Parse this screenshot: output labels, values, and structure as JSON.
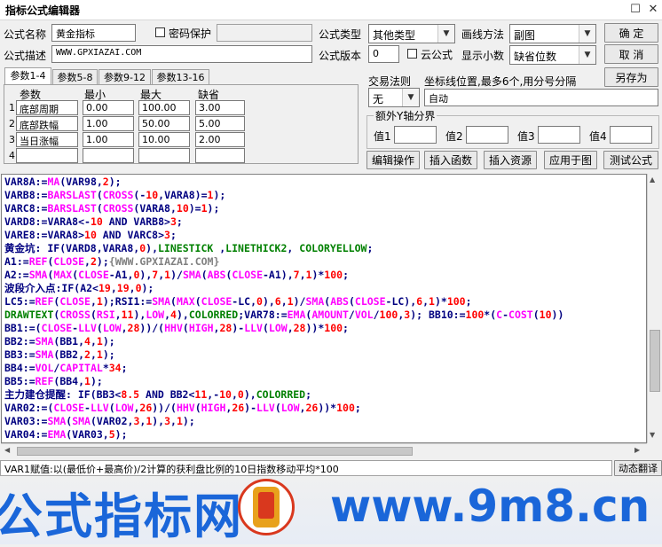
{
  "window": {
    "title": "指标公式编辑器",
    "restore_glyph": "☐",
    "close_glyph": "✕"
  },
  "form": {
    "name_label": "公式名称",
    "name_value": "黄金指标",
    "password_label": "密码保护",
    "desc_label": "公式描述",
    "desc_value": "WWW.GPXIAZAI.COM",
    "type_label": "公式类型",
    "type_value": "其他类型",
    "draw_label": "画线方法",
    "draw_value": "副图",
    "version_label": "公式版本",
    "version_value": "0",
    "cloud_label": "云公式",
    "decimal_label": "显示小数",
    "decimal_value": "缺省位数"
  },
  "buttons": {
    "ok": "确  定",
    "cancel": "取  消",
    "save_as": "另存为"
  },
  "tabs": [
    "参数1-4",
    "参数5-8",
    "参数9-12",
    "参数13-16"
  ],
  "params": {
    "headers": [
      "参数",
      "最小",
      "最大",
      "缺省"
    ],
    "rows": [
      {
        "no": "1",
        "name": "底部周期",
        "min": "0.00",
        "max": "100.00",
        "def": "3.00"
      },
      {
        "no": "2",
        "name": "底部跌幅",
        "min": "1.00",
        "max": "50.00",
        "def": "5.00"
      },
      {
        "no": "3",
        "name": "当日涨幅",
        "min": "1.00",
        "max": "10.00",
        "def": "2.00"
      },
      {
        "no": "4",
        "name": "",
        "min": "",
        "max": "",
        "def": ""
      }
    ]
  },
  "trade": {
    "label": "交易法则",
    "value": "无"
  },
  "axis": {
    "label": "坐标线位置,最多6个,用分号分隔",
    "value": "自动"
  },
  "yaxis": {
    "group_label": "额外Y轴分界",
    "v1": "值1",
    "v2": "值2",
    "v3": "值3",
    "v4": "值4"
  },
  "actions": [
    "编辑操作",
    "插入函数",
    "插入资源",
    "应用于图",
    "测试公式"
  ],
  "code_lines": [
    [
      [
        "VAR8A:=",
        "#000080"
      ],
      [
        "MA",
        "#ff00ff"
      ],
      [
        "(VAR98,",
        "#000080"
      ],
      [
        "2",
        "#ff0000"
      ],
      [
        ");",
        "#000080"
      ]
    ],
    [
      [
        "VARB8:=",
        "#000080"
      ],
      [
        "BARSLAST",
        "#ff00ff"
      ],
      [
        "(",
        "#000080"
      ],
      [
        "CROSS",
        "#ff00ff"
      ],
      [
        "(-",
        "#000080"
      ],
      [
        "10",
        "#ff0000"
      ],
      [
        ",VARA8)=",
        "#000080"
      ],
      [
        "1",
        "#ff0000"
      ],
      [
        ");",
        "#000080"
      ]
    ],
    [
      [
        "VARC8:=",
        "#000080"
      ],
      [
        "BARSLAST",
        "#ff00ff"
      ],
      [
        "(",
        "#000080"
      ],
      [
        "CROSS",
        "#ff00ff"
      ],
      [
        "(VARA8,",
        "#000080"
      ],
      [
        "10",
        "#ff0000"
      ],
      [
        ")=",
        "#000080"
      ],
      [
        "1",
        "#ff0000"
      ],
      [
        ");",
        "#000080"
      ]
    ],
    [
      [
        "VARD8:=VARA8<-",
        "#000080"
      ],
      [
        "10",
        "#ff0000"
      ],
      [
        " AND VARB8>",
        "#000080"
      ],
      [
        "3",
        "#ff0000"
      ],
      [
        ";",
        "#000080"
      ]
    ],
    [
      [
        "VARE8:=VARA8>",
        "#000080"
      ],
      [
        "10",
        "#ff0000"
      ],
      [
        " AND VARC8>",
        "#000080"
      ],
      [
        "3",
        "#ff0000"
      ],
      [
        ";",
        "#000080"
      ]
    ],
    [
      [
        "黄金坑: IF(VARD8,VARA8,",
        "#000080"
      ],
      [
        "0",
        "#ff0000"
      ],
      [
        "),",
        "#000080"
      ],
      [
        "LINESTICK",
        "#008000"
      ],
      [
        " ,",
        "#000080"
      ],
      [
        "LINETHICK2",
        "#008000"
      ],
      [
        ", ",
        "#000080"
      ],
      [
        "COLORYELLOW",
        "#008000"
      ],
      [
        ";",
        "#000080"
      ]
    ],
    [
      [
        "A1:=",
        "#000080"
      ],
      [
        "REF",
        "#ff00ff"
      ],
      [
        "(",
        "#000080"
      ],
      [
        "CLOSE",
        "#ff00ff"
      ],
      [
        ",",
        "#000080"
      ],
      [
        "2",
        "#ff0000"
      ],
      [
        ");",
        "#000080"
      ],
      [
        "{WWW.GPXIAZAI.COM}",
        "#808080"
      ]
    ],
    [
      [
        "A2:=",
        "#000080"
      ],
      [
        "SMA",
        "#ff00ff"
      ],
      [
        "(",
        "#000080"
      ],
      [
        "MAX",
        "#ff00ff"
      ],
      [
        "(",
        "#000080"
      ],
      [
        "CLOSE",
        "#ff00ff"
      ],
      [
        "-A1,",
        "#000080"
      ],
      [
        "0",
        "#ff0000"
      ],
      [
        "),",
        "#000080"
      ],
      [
        "7",
        "#ff0000"
      ],
      [
        ",",
        "#000080"
      ],
      [
        "1",
        "#ff0000"
      ],
      [
        ")/",
        "#000080"
      ],
      [
        "SMA",
        "#ff00ff"
      ],
      [
        "(",
        "#000080"
      ],
      [
        "ABS",
        "#ff00ff"
      ],
      [
        "(",
        "#000080"
      ],
      [
        "CLOSE",
        "#ff00ff"
      ],
      [
        "-A1),",
        "#000080"
      ],
      [
        "7",
        "#ff0000"
      ],
      [
        ",",
        "#000080"
      ],
      [
        "1",
        "#ff0000"
      ],
      [
        ")*",
        "#000080"
      ],
      [
        "100",
        "#ff0000"
      ],
      [
        ";",
        "#000080"
      ]
    ],
    [
      [
        "波段介入点:IF(A2<",
        "#000080"
      ],
      [
        "19",
        "#ff0000"
      ],
      [
        ",",
        "#000080"
      ],
      [
        "19",
        "#ff0000"
      ],
      [
        ",",
        "#000080"
      ],
      [
        "0",
        "#ff0000"
      ],
      [
        ");",
        "#000080"
      ]
    ],
    [
      [
        "LC5:=",
        "#000080"
      ],
      [
        "REF",
        "#ff00ff"
      ],
      [
        "(",
        "#000080"
      ],
      [
        "CLOSE",
        "#ff00ff"
      ],
      [
        ",",
        "#000080"
      ],
      [
        "1",
        "#ff0000"
      ],
      [
        ");RSI1:=",
        "#000080"
      ],
      [
        "SMA",
        "#ff00ff"
      ],
      [
        "(",
        "#000080"
      ],
      [
        "MAX",
        "#ff00ff"
      ],
      [
        "(",
        "#000080"
      ],
      [
        "CLOSE",
        "#ff00ff"
      ],
      [
        "-LC,",
        "#000080"
      ],
      [
        "0",
        "#ff0000"
      ],
      [
        "),",
        "#000080"
      ],
      [
        "6",
        "#ff0000"
      ],
      [
        ",",
        "#000080"
      ],
      [
        "1",
        "#ff0000"
      ],
      [
        ")/",
        "#000080"
      ],
      [
        "SMA",
        "#ff00ff"
      ],
      [
        "(",
        "#000080"
      ],
      [
        "ABS",
        "#ff00ff"
      ],
      [
        "(",
        "#000080"
      ],
      [
        "CLOSE",
        "#ff00ff"
      ],
      [
        "-LC),",
        "#000080"
      ],
      [
        "6",
        "#ff0000"
      ],
      [
        ",",
        "#000080"
      ],
      [
        "1",
        "#ff0000"
      ],
      [
        ")*",
        "#000080"
      ],
      [
        "100",
        "#ff0000"
      ],
      [
        ";",
        "#000080"
      ]
    ],
    [
      [
        "DRAWTEXT",
        "#008000"
      ],
      [
        "(",
        "#000080"
      ],
      [
        "CROSS",
        "#ff00ff"
      ],
      [
        "(",
        "#000080"
      ],
      [
        "RSI",
        "#ff00ff"
      ],
      [
        ",",
        "#000080"
      ],
      [
        "11",
        "#ff0000"
      ],
      [
        "),",
        "#000080"
      ],
      [
        "LOW",
        "#ff00ff"
      ],
      [
        ",",
        "#000080"
      ],
      [
        "4",
        "#ff0000"
      ],
      [
        "),",
        "#000080"
      ],
      [
        "COLORRED",
        "#008000"
      ],
      [
        ";VAR78:=",
        "#000080"
      ],
      [
        "EMA",
        "#ff00ff"
      ],
      [
        "(",
        "#000080"
      ],
      [
        "AMOUNT",
        "#ff00ff"
      ],
      [
        "/",
        "#000080"
      ],
      [
        "VOL",
        "#ff00ff"
      ],
      [
        "/",
        "#000080"
      ],
      [
        "100",
        "#ff0000"
      ],
      [
        ",",
        "#000080"
      ],
      [
        "3",
        "#ff0000"
      ],
      [
        "); BB10:=",
        "#000080"
      ],
      [
        "100",
        "#ff0000"
      ],
      [
        "*(",
        "#000080"
      ],
      [
        "C",
        "#ff00ff"
      ],
      [
        "-",
        "#000080"
      ],
      [
        "COST",
        "#ff00ff"
      ],
      [
        "(",
        "#000080"
      ],
      [
        "10",
        "#ff0000"
      ],
      [
        "))",
        "#000080"
      ]
    ],
    [
      [
        "BB1:=(",
        "#000080"
      ],
      [
        "CLOSE",
        "#ff00ff"
      ],
      [
        "-",
        "#000080"
      ],
      [
        "LLV",
        "#ff00ff"
      ],
      [
        "(",
        "#000080"
      ],
      [
        "LOW",
        "#ff00ff"
      ],
      [
        ",",
        "#000080"
      ],
      [
        "28",
        "#ff0000"
      ],
      [
        "))/(",
        "#000080"
      ],
      [
        "HHV",
        "#ff00ff"
      ],
      [
        "(",
        "#000080"
      ],
      [
        "HIGH",
        "#ff00ff"
      ],
      [
        ",",
        "#000080"
      ],
      [
        "28",
        "#ff0000"
      ],
      [
        ")-",
        "#000080"
      ],
      [
        "LLV",
        "#ff00ff"
      ],
      [
        "(",
        "#000080"
      ],
      [
        "LOW",
        "#ff00ff"
      ],
      [
        ",",
        "#000080"
      ],
      [
        "28",
        "#ff0000"
      ],
      [
        "))*",
        "#000080"
      ],
      [
        "100",
        "#ff0000"
      ],
      [
        ";",
        "#000080"
      ]
    ],
    [
      [
        "BB2:=",
        "#000080"
      ],
      [
        "SMA",
        "#ff00ff"
      ],
      [
        "(BB1,",
        "#000080"
      ],
      [
        "4",
        "#ff0000"
      ],
      [
        ",",
        "#000080"
      ],
      [
        "1",
        "#ff0000"
      ],
      [
        ");",
        "#000080"
      ]
    ],
    [
      [
        "BB3:=",
        "#000080"
      ],
      [
        "SMA",
        "#ff00ff"
      ],
      [
        "(BB2,",
        "#000080"
      ],
      [
        "2",
        "#ff0000"
      ],
      [
        ",",
        "#000080"
      ],
      [
        "1",
        "#ff0000"
      ],
      [
        ");",
        "#000080"
      ]
    ],
    [
      [
        "BB4:=",
        "#000080"
      ],
      [
        "VOL",
        "#ff00ff"
      ],
      [
        "/",
        "#000080"
      ],
      [
        "CAPITAL",
        "#ff00ff"
      ],
      [
        "*",
        "#000080"
      ],
      [
        "34",
        "#ff0000"
      ],
      [
        ";",
        "#000080"
      ]
    ],
    [
      [
        "BB5:=",
        "#000080"
      ],
      [
        "REF",
        "#ff00ff"
      ],
      [
        "(BB4,",
        "#000080"
      ],
      [
        "1",
        "#ff0000"
      ],
      [
        ");",
        "#000080"
      ]
    ],
    [
      [
        "主力建仓提醒: IF(BB3<",
        "#000080"
      ],
      [
        "8.5",
        "#ff0000"
      ],
      [
        " AND BB2<",
        "#000080"
      ],
      [
        "11",
        "#ff0000"
      ],
      [
        ",-",
        "#000080"
      ],
      [
        "10",
        "#ff0000"
      ],
      [
        ",",
        "#000080"
      ],
      [
        "0",
        "#ff0000"
      ],
      [
        "),",
        "#000080"
      ],
      [
        "COLORRED",
        "#008000"
      ],
      [
        ";",
        "#000080"
      ]
    ],
    [
      [
        "VAR02:=(",
        "#000080"
      ],
      [
        "CLOSE",
        "#ff00ff"
      ],
      [
        "-",
        "#000080"
      ],
      [
        "LLV",
        "#ff00ff"
      ],
      [
        "(",
        "#000080"
      ],
      [
        "LOW",
        "#ff00ff"
      ],
      [
        ",",
        "#000080"
      ],
      [
        "26",
        "#ff0000"
      ],
      [
        "))/(",
        "#000080"
      ],
      [
        "HHV",
        "#ff00ff"
      ],
      [
        "(",
        "#000080"
      ],
      [
        "HIGH",
        "#ff00ff"
      ],
      [
        ",",
        "#000080"
      ],
      [
        "26",
        "#ff0000"
      ],
      [
        ")-",
        "#000080"
      ],
      [
        "LLV",
        "#ff00ff"
      ],
      [
        "(",
        "#000080"
      ],
      [
        "LOW",
        "#ff00ff"
      ],
      [
        ",",
        "#000080"
      ],
      [
        "26",
        "#ff0000"
      ],
      [
        "))*",
        "#000080"
      ],
      [
        "100",
        "#ff0000"
      ],
      [
        ";",
        "#000080"
      ]
    ],
    [
      [
        "VAR03:=",
        "#000080"
      ],
      [
        "SMA",
        "#ff00ff"
      ],
      [
        "(",
        "#000080"
      ],
      [
        "SMA",
        "#ff00ff"
      ],
      [
        "(VAR02,",
        "#000080"
      ],
      [
        "3",
        "#ff0000"
      ],
      [
        ",",
        "#000080"
      ],
      [
        "1",
        "#ff0000"
      ],
      [
        "),",
        "#000080"
      ],
      [
        "3",
        "#ff0000"
      ],
      [
        ",",
        "#000080"
      ],
      [
        "1",
        "#ff0000"
      ],
      [
        ");",
        "#000080"
      ]
    ],
    [
      [
        "VAR04:=",
        "#000080"
      ],
      [
        "EMA",
        "#ff00ff"
      ],
      [
        "(VAR03,",
        "#000080"
      ],
      [
        "5",
        "#ff0000"
      ],
      [
        ");",
        "#000080"
      ]
    ]
  ],
  "status": {
    "text": "VAR1赋值:以(最低价+最高价)/2计算的获利盘比例的10日指数移动平均*100",
    "translate": "动态翻译"
  },
  "banner": {
    "left_text": "公式指标网",
    "right_text": "www.9m8.cn",
    "text_color": "#1a66d9"
  }
}
